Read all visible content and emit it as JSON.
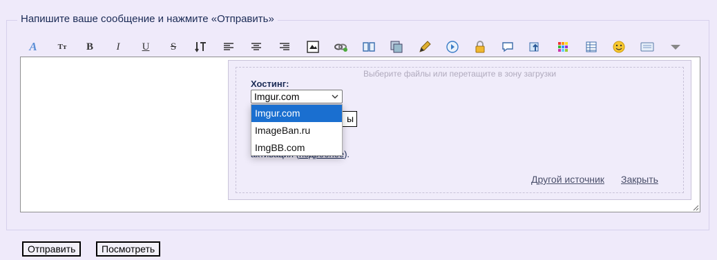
{
  "form": {
    "legend": "Напишите ваше сообщение и нажмите «Отправить»"
  },
  "toolbar": {
    "font_label": "Tт",
    "bold_label": "B",
    "italic_label": "I",
    "underline_label": "U",
    "strike_label": "S",
    "icons": [
      "font-color-icon",
      "font-size-icon",
      "bold-icon",
      "italic-icon",
      "underline-icon",
      "strikethrough-icon",
      "line-height-icon",
      "align-left-icon",
      "align-center-icon",
      "align-right-icon",
      "image-icon",
      "link-icon",
      "book-icon",
      "gallery-icon",
      "pencil-icon",
      "play-icon",
      "lock-icon",
      "speech-bubble-icon",
      "upload-icon",
      "color-grid-icon",
      "table-icon",
      "smiley-icon",
      "keyboard-icon",
      "more-dropdown-icon"
    ]
  },
  "upload": {
    "dropzone_hint": "Выберите файлы или перетащите в зону загрузки",
    "hosting_label": "Хостинг:",
    "selected_host": "Imgur.com",
    "hosting_options": [
      "Imgur.com",
      "ImageBan.ru",
      "ImgBB.com"
    ],
    "hidden_button_tail": "ы",
    "activation_prefix": "активация (",
    "activation_link": "подробнее",
    "activation_suffix": ").",
    "other_source_link": "Другой источник",
    "close_link": "Закрыть"
  },
  "actions": {
    "submit_label": "Отправить",
    "preview_label": "Посмотреть"
  },
  "colors": {
    "background": "#efeafa",
    "selected_option": "#1a6fd0",
    "legend_text": "#1a2a55"
  }
}
